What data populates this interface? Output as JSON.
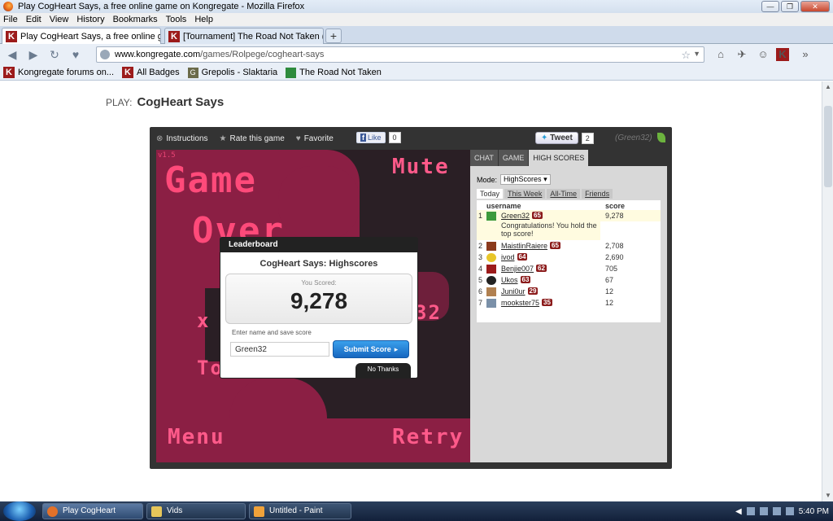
{
  "window": {
    "title": "Play CogHeart Says, a free online game on Kongregate - Mozilla Firefox",
    "controls": {
      "minimize": "—",
      "maximize": "❐",
      "close": "✕"
    }
  },
  "menu": [
    "File",
    "Edit",
    "View",
    "History",
    "Bookmarks",
    "Tools",
    "Help"
  ],
  "tabs": [
    {
      "label": "Play CogHeart Says, a free online ga...",
      "close": "✕"
    },
    {
      "label": "[Tournament] The Road Not Taken (...",
      "close": "✕"
    }
  ],
  "new_tab": "+",
  "url": {
    "host": "www.kongregate.com",
    "path": "/games/Rolpege/cogheart-says"
  },
  "bookmarks": [
    {
      "label": "Kongregate forums on...",
      "icon": "K"
    },
    {
      "label": "All Badges",
      "icon": "K"
    },
    {
      "label": "Grepolis - Slaktaria",
      "icon": "G"
    },
    {
      "label": "The Road Not Taken",
      "icon": "sheet"
    }
  ],
  "page": {
    "play_label": "PLAY:",
    "game_title": "CogHeart Says"
  },
  "game_toolbar": {
    "instructions": "Instructions",
    "rate": "Rate this game",
    "favorite": "Favorite",
    "like": "Like",
    "like_count": "0",
    "tweet": "Tweet",
    "tweet_count": "2",
    "user": "(Green32)"
  },
  "game": {
    "version": "v1.5",
    "title_text": "Game",
    "over_text": "Over",
    "mute": "Mute",
    "menu": "Menu",
    "retry": "Retry",
    "frag1": "x",
    "frag2": "32",
    "frag3": "To"
  },
  "modal": {
    "header": "Leaderboard",
    "title": "CogHeart Says: Highscores",
    "you_scored": "You Scored:",
    "score": "9,278",
    "enter_label": "Enter name and save score",
    "name_value": "Green32",
    "submit": "Submit Score",
    "no_thanks": "No Thanks"
  },
  "panel": {
    "tabs": [
      "CHAT",
      "GAME",
      "HIGH SCORES"
    ],
    "mode_label": "Mode:",
    "mode_value": "HighScores",
    "ranges": [
      "Today",
      "This Week",
      "All-Time",
      "Friends"
    ],
    "col_username": "username",
    "col_score": "score",
    "congrats": "Congratulations! You hold the top score!",
    "rows": [
      {
        "rank": "1",
        "name": "Green32",
        "level": "65",
        "score": "9,278",
        "color": "#3c9a3c"
      },
      {
        "rank": "2",
        "name": "MaistlinRaiere",
        "level": "65",
        "score": "2,708",
        "color": "#8b3a1e"
      },
      {
        "rank": "3",
        "name": "ivod",
        "level": "64",
        "score": "2,690",
        "color": "#e8c62a"
      },
      {
        "rank": "4",
        "name": "Benjie007",
        "level": "62",
        "score": "705",
        "color": "#9c1b1b"
      },
      {
        "rank": "5",
        "name": "Ukos",
        "level": "63",
        "score": "67",
        "color": "#222222"
      },
      {
        "rank": "6",
        "name": "Juni0ur",
        "level": "29",
        "score": "12",
        "color": "#b08050"
      },
      {
        "rank": "7",
        "name": "mookster75",
        "level": "35",
        "score": "12",
        "color": "#7a90a8"
      }
    ]
  },
  "taskbar": {
    "items": [
      {
        "label": "Play CogHeart Says,..."
      },
      {
        "label": "Vids"
      },
      {
        "label": "Untitled - Paint"
      }
    ],
    "clock": "5:40 PM"
  }
}
